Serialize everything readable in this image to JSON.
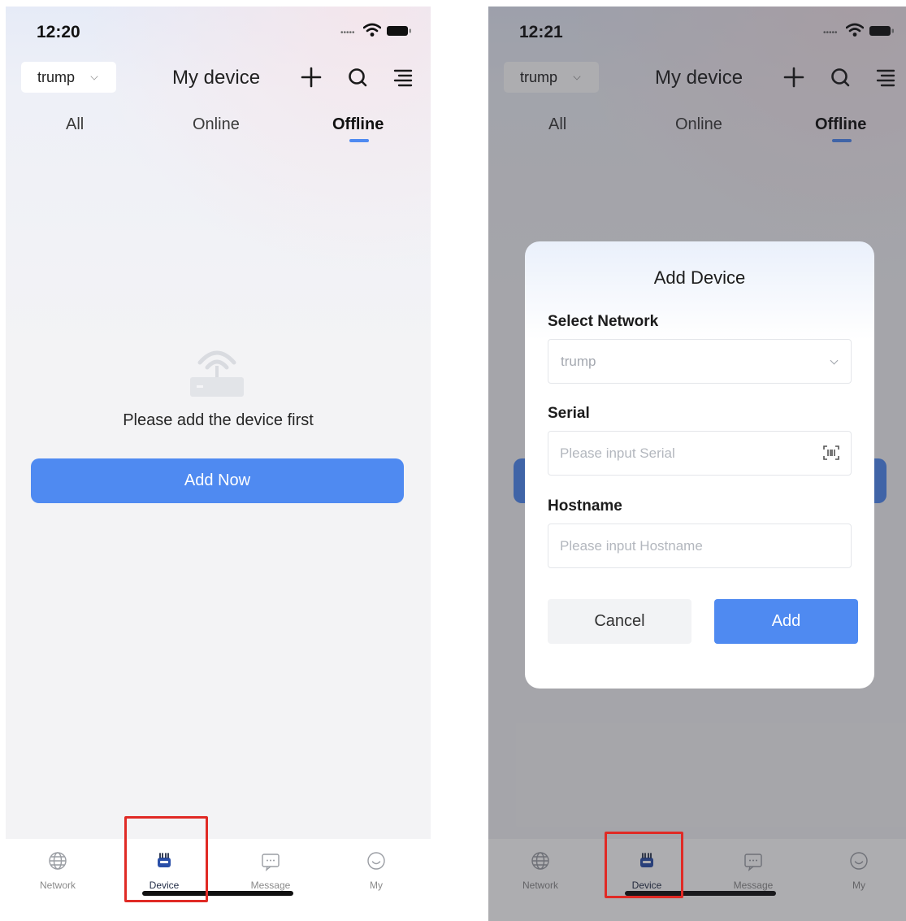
{
  "screens": [
    {
      "time": "12:20",
      "network_select": "trump",
      "title": "My device",
      "tabs": [
        "All",
        "Online",
        "Offline"
      ],
      "active_tab": "Offline",
      "empty_text": "Please add the device first",
      "add_now": "Add Now",
      "tabbar": [
        "Network",
        "Device",
        "Message",
        "My"
      ],
      "active_tabbar": "Device"
    },
    {
      "time": "12:21",
      "network_select": "trump",
      "title": "My device",
      "tabs": [
        "All",
        "Online",
        "Offline"
      ],
      "active_tab": "Offline",
      "tabbar": [
        "Network",
        "Device",
        "Message",
        "My"
      ],
      "active_tabbar": "Device",
      "dialog": {
        "title": "Add Device",
        "network_label": "Select Network",
        "network_value": "trump",
        "serial_label": "Serial",
        "serial_placeholder": "Please input Serial",
        "hostname_label": "Hostname",
        "hostname_placeholder": "Please input Hostname",
        "cancel": "Cancel",
        "add": "Add"
      }
    }
  ],
  "colors": {
    "accent": "#4f8af1",
    "highlight": "#e02a25",
    "background": "#f3f3f5"
  }
}
